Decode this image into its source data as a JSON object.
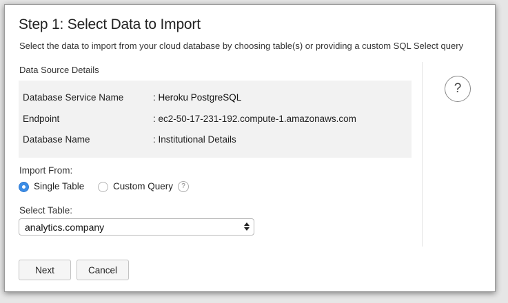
{
  "dialog": {
    "title": "Step 1: Select Data to Import",
    "subtitle": "Select the data to import from your cloud database by choosing table(s) or providing a custom SQL Select query"
  },
  "data_source": {
    "section_label": "Data Source Details",
    "rows": [
      {
        "label": "Database Service Name",
        "value": ": Heroku PostgreSQL"
      },
      {
        "label": "Endpoint",
        "value": ": ec2-50-17-231-192.compute-1.amazonaws.com"
      },
      {
        "label": "Database Name",
        "value": ": Institutional Details"
      }
    ]
  },
  "help": {
    "icon": "question-mark-icon",
    "glyph": "?"
  },
  "import_from": {
    "label": "Import From:",
    "options": [
      {
        "label": "Single Table",
        "selected": true
      },
      {
        "label": "Custom Query",
        "selected": false
      }
    ],
    "help_glyph": "?"
  },
  "select_table": {
    "label": "Select Table:",
    "value": "analytics.company"
  },
  "buttons": {
    "next": "Next",
    "cancel": "Cancel"
  },
  "colors": {
    "accent": "#3b8ce6",
    "details_bg": "#f2f2f2"
  }
}
